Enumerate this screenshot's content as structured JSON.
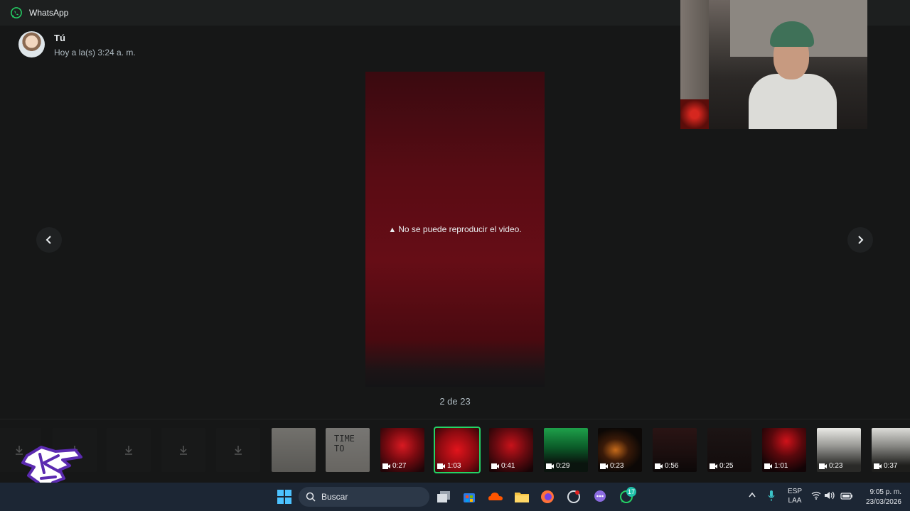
{
  "titlebar": {
    "app_name": "WhatsApp"
  },
  "sender": {
    "name": "Tú",
    "time": "Hoy a la(s) 3:24 a. m."
  },
  "viewer": {
    "error": "No se puede reproducir el video.",
    "counter": "2 de 23"
  },
  "thumbnails": [
    {
      "duration": "0:27"
    },
    {
      "duration": "1:03"
    },
    {
      "duration": "0:41"
    },
    {
      "duration": "0:29"
    },
    {
      "duration": "0:23"
    },
    {
      "duration": "0:56"
    },
    {
      "duration": "0:25"
    },
    {
      "duration": "1:01"
    },
    {
      "duration": "0:23"
    },
    {
      "duration": "0:37"
    }
  ],
  "doc_thumb_text": "TIME TO",
  "taskbar": {
    "search_placeholder": "Buscar",
    "whatsapp_badge": "17",
    "lang_top": "ESP",
    "lang_bottom": "LAA",
    "clock_time": "9:05 p. m.",
    "clock_date": "23/03/2026"
  },
  "colors": {
    "accent": "#25d366",
    "background": "#161717",
    "taskbar": "#1c2634"
  }
}
